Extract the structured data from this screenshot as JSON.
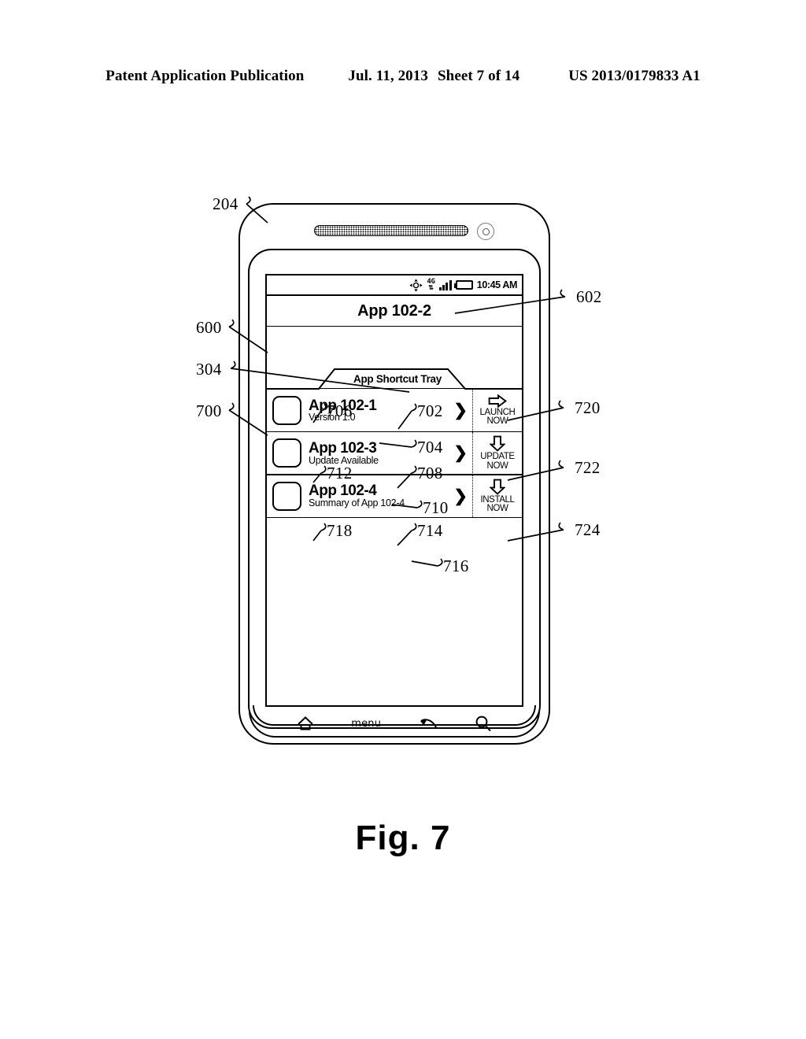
{
  "header": {
    "publication": "Patent Application Publication",
    "date": "Jul. 11, 2013",
    "sheet": "Sheet 7 of 14",
    "patent_number": "US 2013/0179833 A1"
  },
  "figure": {
    "caption": "Fig. 7"
  },
  "phone": {
    "status_bar": {
      "gps_icon": "gps-crosshair-icon",
      "network_label": "4G",
      "network_arrows": "⇅",
      "signal_icon": "signal-bars-icon",
      "battery_icon": "battery-icon",
      "time": "10:45 AM"
    },
    "title_bar": {
      "title": "App 102-2"
    },
    "tray": {
      "tab_label": "App Shortcut Tray"
    },
    "rows": [
      {
        "icon": "app-icon",
        "title": "App 102-1",
        "subtitle": "Version 1.0",
        "chevron": "❯",
        "action_arrow": "arrow-right-icon",
        "action_label": "LAUNCH\nNOW",
        "ref_icon": "706",
        "ref_title": "702",
        "ref_subtitle": "704",
        "ref_action": "720"
      },
      {
        "icon": "app-icon",
        "title": "App 102-3",
        "subtitle": "Update Available",
        "chevron": "❯",
        "action_arrow": "arrow-down-icon",
        "action_label": "UPDATE\nNOW",
        "ref_icon": "712",
        "ref_title": "708",
        "ref_subtitle": "710",
        "ref_action": "722"
      },
      {
        "icon": "app-icon",
        "title": "App 102-4",
        "subtitle": "Summary of App 102-4",
        "chevron": "❯",
        "action_arrow": "arrow-down-icon",
        "action_label": "INSTALL\nNOW",
        "ref_icon": "718",
        "ref_title": "714",
        "ref_subtitle": "716",
        "ref_action": "724"
      }
    ],
    "nav_bar": {
      "home_icon": "home-icon",
      "menu_label": "menu",
      "back_icon": "back-arrow-icon",
      "search_icon": "search-icon"
    }
  },
  "reference_numerals": {
    "device": "204",
    "screen": "600",
    "tray": "304",
    "list": "700",
    "title_bar": "602",
    "launch_action": "720",
    "update_action": "722",
    "install_action": "724",
    "row1_icon": "706",
    "row1_title": "702",
    "row1_subtitle": "704",
    "row2_icon": "712",
    "row2_title": "708",
    "row2_subtitle": "710",
    "row3_icon": "718",
    "row3_title": "714",
    "row3_subtitle": "716"
  }
}
